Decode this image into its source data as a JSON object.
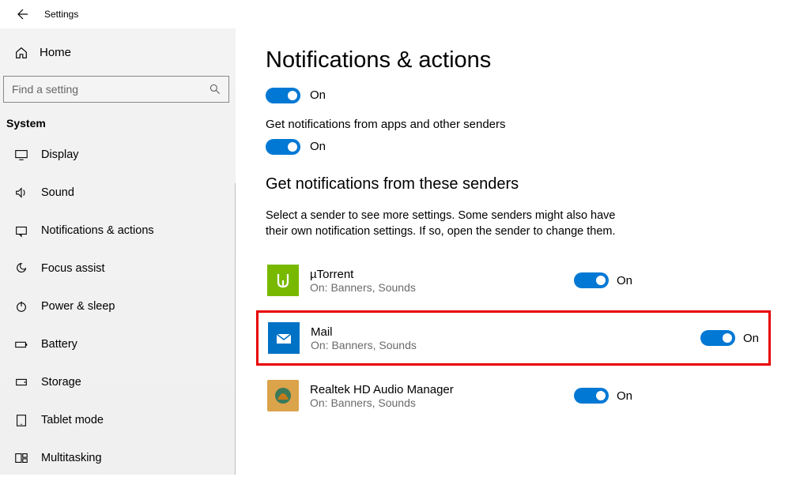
{
  "window": {
    "title": "Settings"
  },
  "sidebar": {
    "home": "Home",
    "search_placeholder": "Find a setting",
    "group": "System",
    "items": [
      {
        "label": "Display",
        "icon": "display-icon"
      },
      {
        "label": "Sound",
        "icon": "sound-icon"
      },
      {
        "label": "Notifications & actions",
        "icon": "notifications-icon"
      },
      {
        "label": "Focus assist",
        "icon": "focus-assist-icon"
      },
      {
        "label": "Power & sleep",
        "icon": "power-icon"
      },
      {
        "label": "Battery",
        "icon": "battery-icon"
      },
      {
        "label": "Storage",
        "icon": "storage-icon"
      },
      {
        "label": "Tablet mode",
        "icon": "tablet-icon"
      },
      {
        "label": "Multitasking",
        "icon": "multitasking-icon"
      }
    ]
  },
  "main": {
    "heading": "Notifications & actions",
    "master_toggle": {
      "state": "On"
    },
    "app_desc": "Get notifications from apps and other senders",
    "app_toggle": {
      "state": "On"
    },
    "senders_heading": "Get notifications from these senders",
    "senders_help": "Select a sender to see more settings. Some senders might also have their own notification settings. If so, open the sender to change them.",
    "senders": [
      {
        "name": "µTorrent",
        "sub": "On: Banners, Sounds",
        "state": "On",
        "highlight": false
      },
      {
        "name": "Mail",
        "sub": "On: Banners, Sounds",
        "state": "On",
        "highlight": true
      },
      {
        "name": "Realtek HD Audio Manager",
        "sub": "On: Banners, Sounds",
        "state": "On",
        "highlight": false
      }
    ]
  }
}
